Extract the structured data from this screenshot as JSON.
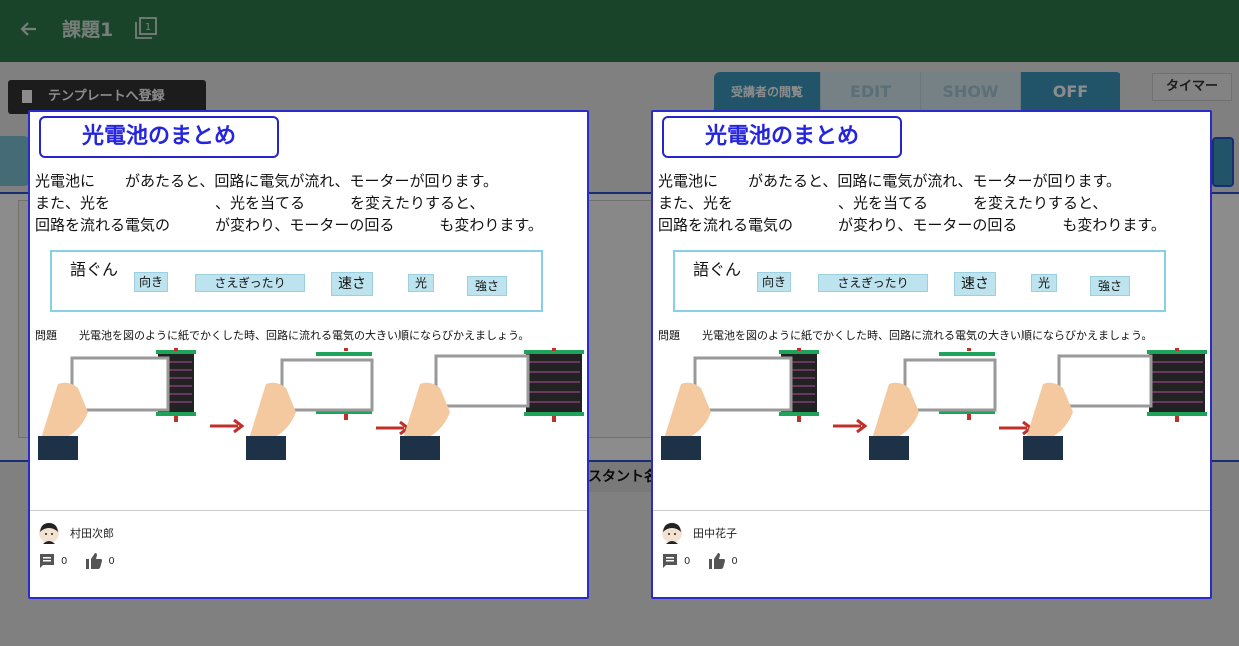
{
  "header": {
    "title": "課題1",
    "copy_count": "1"
  },
  "toolbar": {
    "template_button": "テンプレートへ登録",
    "timer_button": "タイマー"
  },
  "viewer_toggle": {
    "label": "受講者の閲覧",
    "options": [
      "EDIT",
      "SHOW",
      "OFF"
    ],
    "selected": "OFF"
  },
  "background": {
    "assistant_label": "スタント名"
  },
  "cards": [
    {
      "sheet": {
        "title": "光電池のまとめ",
        "lines": [
          "光電池に　　があたると、回路に電気が流れ、モーターが回ります。",
          "また、光を　　　　　　　、光を当てる　　　を変えたりすると、",
          "回路を流れる電気の　　　が変わり、モーターの回る　　　も変わります。"
        ],
        "word_box_label": "語ぐん",
        "words": [
          "向き",
          "さえぎったり",
          "速さ",
          "光",
          "強さ"
        ],
        "question_label": "問題",
        "question_text": "光電池を図のように紙でかくした時、回路に流れる電気の大きい順にならびかえましょう。"
      },
      "author": "村田次郎",
      "comments": "0",
      "likes": "0"
    },
    {
      "sheet": {
        "title": "光電池のまとめ",
        "lines": [
          "光電池に　　があたると、回路に電気が流れ、モーターが回ります。",
          "また、光を　　　　　　　、光を当てる　　　を変えたりすると、",
          "回路を流れる電気の　　　が変わり、モーターの回る　　　も変わります。"
        ],
        "word_box_label": "語ぐん",
        "words": [
          "向き",
          "さえぎったり",
          "速さ",
          "光",
          "強さ"
        ],
        "question_label": "問題",
        "question_text": "光電池を図のように紙でかくした時、回路に流れる電気の大きい順にならびかえましょう。"
      },
      "author": "田中花子",
      "comments": "0",
      "likes": "0"
    }
  ],
  "colors": {
    "header_green": "#2f7d4e",
    "accent_blue": "#3d9ac0",
    "card_border": "#2b2bcc",
    "title_blue": "#2525e0"
  }
}
